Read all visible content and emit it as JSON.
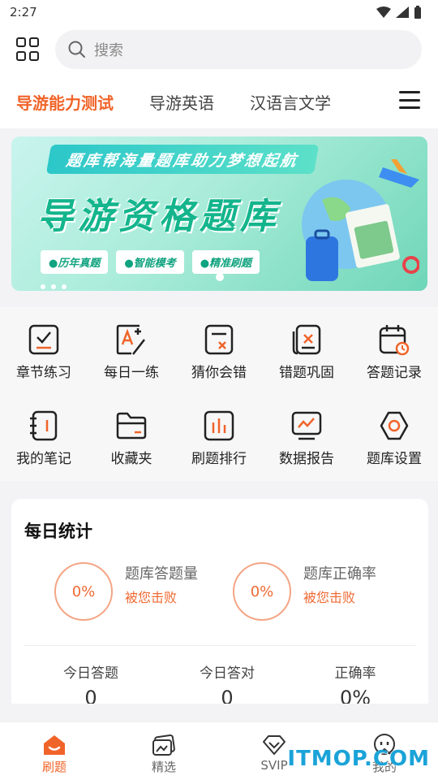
{
  "status_bar": {
    "time": "2:27"
  },
  "search": {
    "placeholder": "搜索"
  },
  "tabs": [
    {
      "label": "导游能力测试",
      "active": true
    },
    {
      "label": "导游英语",
      "active": false
    },
    {
      "label": "汉语言文学",
      "active": false
    }
  ],
  "banner": {
    "ribbon": "题库帮海量题库助力梦想起航",
    "title": "导游资格题库",
    "tags": [
      "●历年真题",
      "●智能模考",
      "●精准刷题"
    ]
  },
  "features": [
    {
      "label": "章节练习",
      "icon": "checklist-icon"
    },
    {
      "label": "每日一练",
      "icon": "edit-a-icon"
    },
    {
      "label": "猜你会错",
      "icon": "wrong-doc-icon"
    },
    {
      "label": "错题巩固",
      "icon": "wrong-book-icon"
    },
    {
      "label": "答题记录",
      "icon": "calendar-clock-icon"
    },
    {
      "label": "我的笔记",
      "icon": "notebook-icon"
    },
    {
      "label": "收藏夹",
      "icon": "folder-icon"
    },
    {
      "label": "刷题排行",
      "icon": "bar-chart-icon"
    },
    {
      "label": "数据报告",
      "icon": "monitor-chart-icon"
    },
    {
      "label": "题库设置",
      "icon": "gear-icon"
    }
  ],
  "daily_stats": {
    "title": "每日统计",
    "rings": [
      {
        "value": "0%",
        "label": "题库答题量",
        "sub": "被您击败"
      },
      {
        "value": "0%",
        "label": "题库正确率",
        "sub": "被您击败"
      }
    ],
    "metrics": [
      {
        "label": "今日答题",
        "value": "0"
      },
      {
        "label": "今日答对",
        "value": "0"
      },
      {
        "label": "正确率",
        "value": "0%"
      }
    ]
  },
  "bottom_nav": [
    {
      "label": "刷题",
      "active": true
    },
    {
      "label": "精选",
      "active": false
    },
    {
      "label": "SVIP",
      "active": false
    },
    {
      "label": "我的",
      "active": false
    }
  ],
  "watermark": "ITMOP.COM",
  "colors": {
    "accent": "#f0642a",
    "banner_green": "#14b58c"
  }
}
